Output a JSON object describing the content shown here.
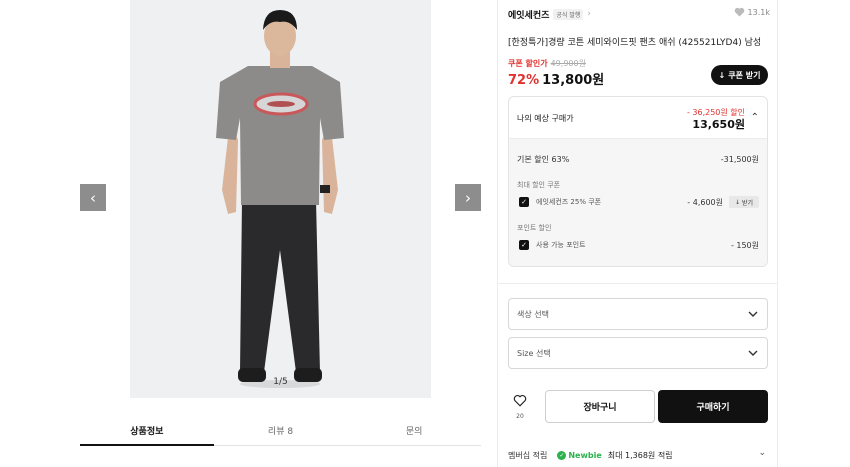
{
  "gallery": {
    "counter": "1/5",
    "prev_icon": "chevron-left-icon",
    "next_icon": "chevron-right-icon"
  },
  "tabs": [
    {
      "label": "상품정보",
      "active": true
    },
    {
      "label": "리뷰 8",
      "active": false
    },
    {
      "label": "문의",
      "active": false
    }
  ],
  "product": {
    "brand": "에잇세컨즈",
    "brand_badge": "공식 발행",
    "likes": "13.1k",
    "title": "[한정특가]경량 코튼 세미와이드핏 팬츠 애쉬 (425521LYD4) 남성",
    "coupon_tag": "쿠폰 할인가",
    "original_price": "49,900원",
    "discount_rate": "72%",
    "price": "13,800원",
    "coupon_button": "쿠폰 받기"
  },
  "estimate": {
    "label": "나의 예상 구매가",
    "total_discount": "- 36,250원 할인",
    "price": "13,650원",
    "base_discount_label": "기본 할인 63%",
    "base_discount_value": "-31,500원",
    "coupon_section": "최대 할인 쿠폰",
    "coupon_label": "에잇세컨즈 25% 쿠폰",
    "coupon_value": "- 4,600원",
    "coupon_get": "받기",
    "point_section": "포인트 할인",
    "point_label": "사용 가능 포인트",
    "point_value": "- 150원"
  },
  "options": {
    "color_placeholder": "색상 선택",
    "size_placeholder": "Size 선택"
  },
  "actions": {
    "wish_count": "20",
    "cart": "장바구니",
    "buy": "구매하기"
  },
  "membership": {
    "label": "멤버십 적립",
    "tier": "Newbie",
    "text": "최대 1,368원 적립"
  },
  "colors": {
    "accent_red": "#e0322f",
    "dark": "#111111",
    "newbie_green": "#2bb24c"
  }
}
